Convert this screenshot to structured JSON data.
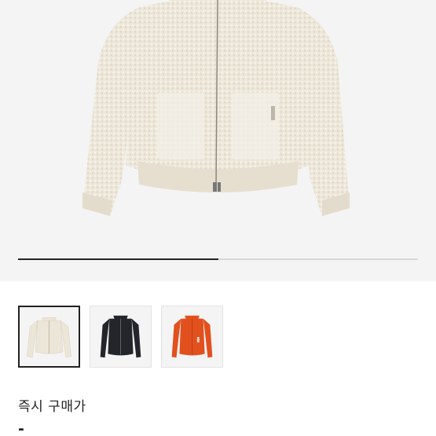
{
  "product": {
    "gallery": {
      "main_image": "cream-boucle-zip-hoodie",
      "slide_progress": 0.5
    },
    "thumbnails": [
      {
        "color_name": "cream",
        "color": "#ece6d8",
        "selected": true
      },
      {
        "color_name": "black",
        "color": "#23252b",
        "selected": false
      },
      {
        "color_name": "orange",
        "color": "#e2501e",
        "selected": false
      }
    ],
    "price": {
      "label": "즉시 구매가",
      "value": "-"
    }
  }
}
